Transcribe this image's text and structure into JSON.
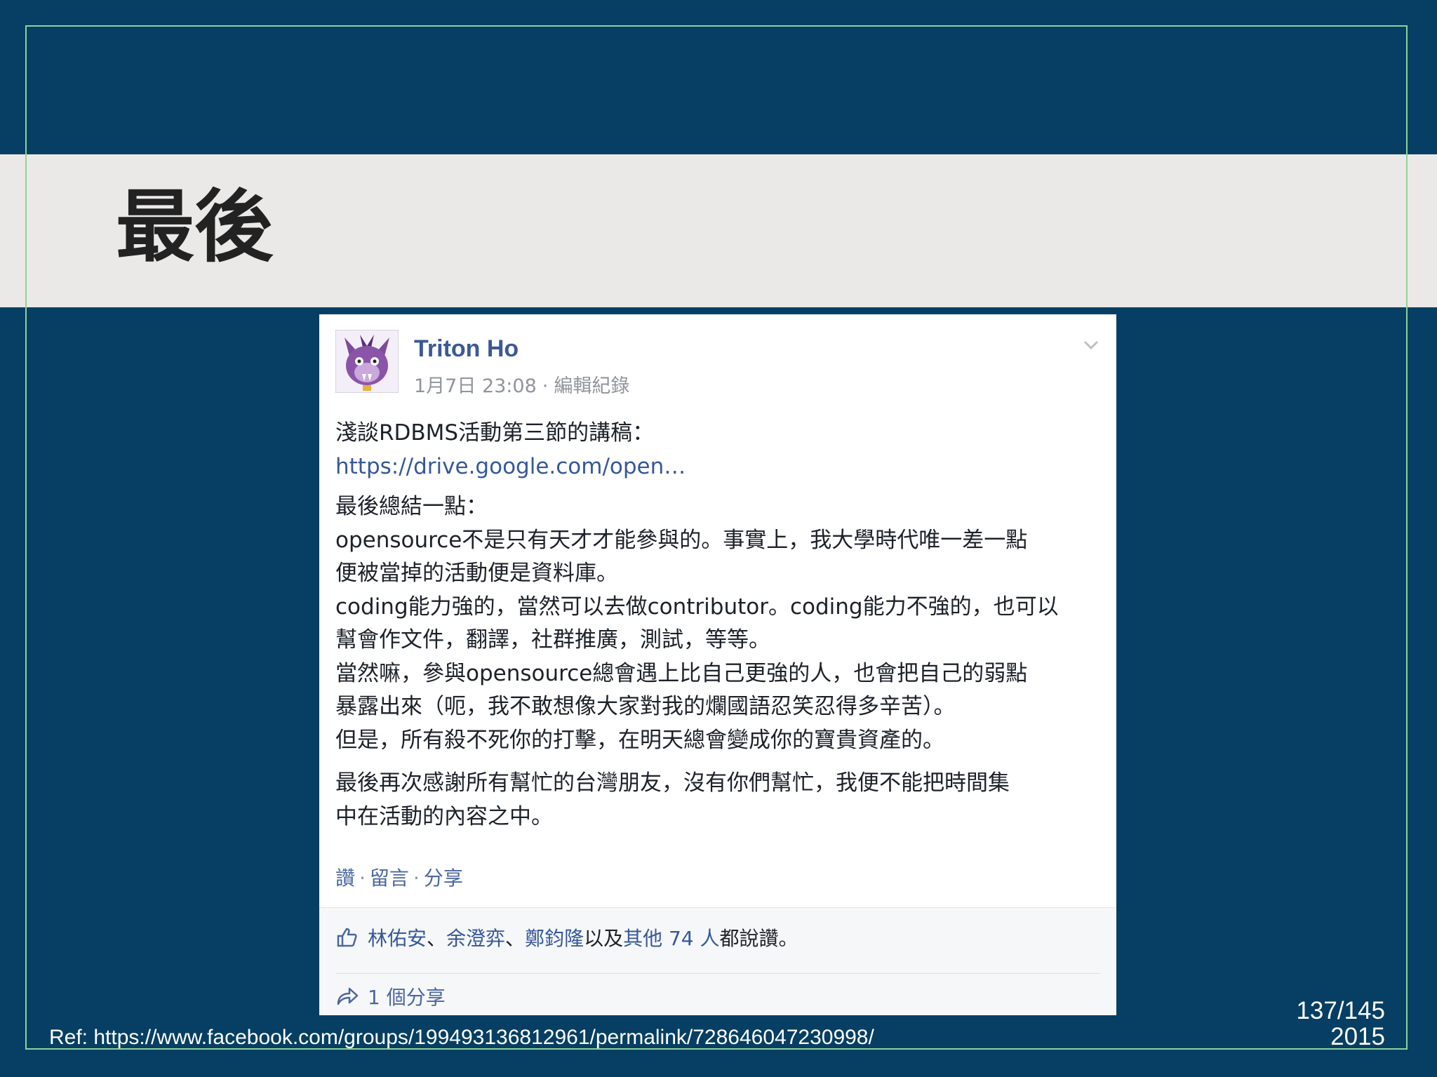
{
  "slide": {
    "title": "最後",
    "page_number": "137/145",
    "year": "2015",
    "reference": "Ref: https://www.facebook.com/groups/199493136812961/permalink/728646047230998/"
  },
  "post": {
    "author": "Triton Ho",
    "timestamp": "1月7日 23:08",
    "meta_separator": "·",
    "edit_history": "編輯紀錄",
    "avatar_icon": "purple-cat-avatar-icon",
    "menu_icon": "chevron-down-icon",
    "body": {
      "intro": "淺談RDBMS活動第三節的講稿：",
      "link": "https://drive.google.com/open…",
      "p1_line1": "最後總結一點：",
      "p1_line2": "opensource不是只有天才才能參與的。事實上，我大學時代唯一差一點",
      "p1_line3": "便被當掉的活動便是資料庫。",
      "p1_line4": "coding能力強的，當然可以去做contributor。coding能力不強的，也可以",
      "p1_line5": "幫會作文件，翻譯，社群推廣，測試，等等。",
      "p1_line6": "當然嘛，參與opensource總會遇上比自己更強的人，也會把自己的弱點",
      "p1_line7": "暴露出來（呃，我不敢想像大家對我的爛國語忍笑忍得多辛苦）。",
      "p1_line8": "但是，所有殺不死你的打擊，在明天總會變成你的寶貴資產的。",
      "p2_line1": "最後再次感謝所有幫忙的台灣朋友，沒有你們幫忙，我便不能把時間集",
      "p2_line2": "中在活動的內容之中。"
    },
    "actions": {
      "like": "讚",
      "comment": "留言",
      "share": "分享",
      "separator": "·"
    },
    "likes": {
      "icon": "thumbs-up-icon",
      "name1": "林佑安",
      "name2": "余澄弈",
      "name3": "鄭鈞隆",
      "delim": "、",
      "conj": "以及",
      "others": "其他 74 人",
      "suffix": "都說讚。"
    },
    "shares": {
      "icon": "share-arrow-icon",
      "label": "1 個分享"
    }
  },
  "colors": {
    "slide_background": "#063f63",
    "title_band": "#ebe9e8",
    "frame_border": "#8fd19a",
    "facebook_link": "#365899",
    "author_name": "#3b5998"
  }
}
